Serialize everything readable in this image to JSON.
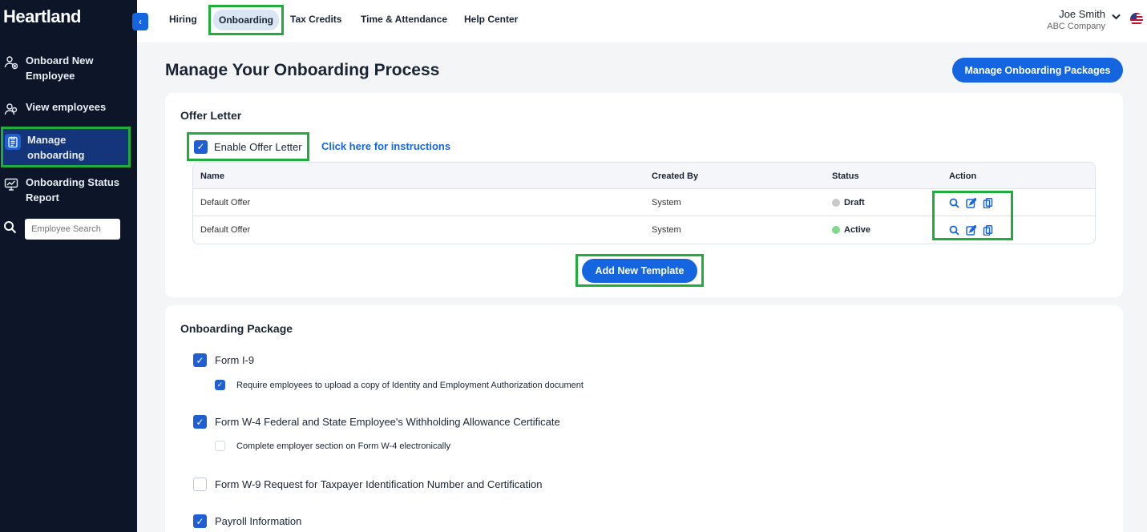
{
  "brand": {
    "logo": "Heartland"
  },
  "sidebar": {
    "items": [
      {
        "label_line1": "Onboard New",
        "label_line2": "Employee",
        "icon": "user-add-icon"
      },
      {
        "label_line1": "View employees",
        "label_line2": "",
        "icon": "users-icon"
      },
      {
        "label_line1": "Manage",
        "label_line2": "onboarding",
        "icon": "clipboard-icon"
      },
      {
        "label_line1": "Onboarding Status",
        "label_line2": "Report",
        "icon": "chart-icon"
      }
    ],
    "search_placeholder": "Employee Search"
  },
  "topnav": {
    "tabs": [
      "Hiring",
      "Onboarding",
      "Tax Credits",
      "Time & Attendance",
      "Help Center"
    ],
    "active_tab": "Onboarding",
    "user_name": "Joe Smith",
    "company": "ABC Company"
  },
  "page": {
    "title": "Manage Your Onboarding Process",
    "manage_packages_button": "Manage Onboarding Packages"
  },
  "offer_letter": {
    "title": "Offer Letter",
    "enable_label": "Enable Offer Letter",
    "enable_checked": true,
    "instructions_link": "Click here for instructions",
    "columns": [
      "Name",
      "Created By",
      "Status",
      "Action"
    ],
    "rows": [
      {
        "name": "Default Offer",
        "created_by": "System",
        "status": "Draft",
        "status_color": "#c7c9cc"
      },
      {
        "name": "Default Offer",
        "created_by": "System",
        "status": "Active",
        "status_color": "#7ed98c"
      }
    ],
    "add_button": "Add New Template"
  },
  "onboarding_package": {
    "title": "Onboarding Package",
    "items": [
      {
        "label": "Form I-9",
        "checked": true,
        "sub": {
          "label": "Require employees to upload a copy of Identity and Employment Authorization document",
          "checked": true
        }
      },
      {
        "label": "Form W-4 Federal and State Employee's Withholding Allowance Certificate",
        "checked": true,
        "sub": {
          "label": "Complete employer section on Form W-4 electronically",
          "checked": false
        }
      },
      {
        "label": "Form W-9 Request for Taxpayer Identification Number and Certification",
        "checked": false
      },
      {
        "label": "Payroll Information",
        "checked": true
      }
    ]
  },
  "colors": {
    "accent": "#1565e0",
    "sidebar_bg": "#0c1628",
    "highlight": "#1fae3c"
  }
}
